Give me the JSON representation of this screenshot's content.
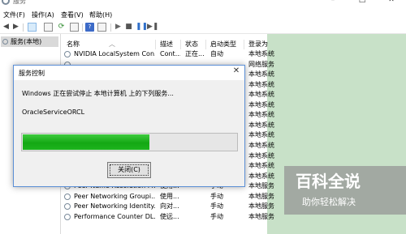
{
  "window": {
    "title": "服务"
  },
  "menu": [
    "文件(F)",
    "操作(A)",
    "查看(V)",
    "帮助(H)"
  ],
  "toolbar": {
    "icons": [
      "back-arrow-icon",
      "forward-arrow-icon",
      "console-tree-icon",
      "list-view-icon",
      "refresh-icon",
      "export-list-icon",
      "help-icon",
      "properties-icon",
      "start-icon",
      "stop-icon",
      "pause-icon",
      "restart-icon"
    ],
    "help_glyph": "?"
  },
  "tree": {
    "root_label": "服务(本地)"
  },
  "columns": {
    "name": "名称",
    "description": "描述",
    "status": "状态",
    "startup": "启动类型",
    "logon": "登录为"
  },
  "services": [
    {
      "name": "NVIDIA LocalSystem Con...",
      "description": "Cont...",
      "status": "正在...",
      "startup": "自动",
      "logon": "本地系统"
    },
    {
      "name": "",
      "description": "",
      "status": "",
      "startup": "",
      "logon": "网络服务"
    },
    {
      "name": "",
      "description": "",
      "status": "",
      "startup": "",
      "logon": "本地系统"
    },
    {
      "name": "",
      "description": "",
      "status": "",
      "startup": "",
      "logon": "本地系统"
    },
    {
      "name": "",
      "description": "",
      "status": "",
      "startup": "",
      "logon": "本地系统"
    },
    {
      "name": "",
      "description": "",
      "status": "",
      "startup": "",
      "logon": "本地系统"
    },
    {
      "name": "",
      "description": "",
      "status": "",
      "startup": "",
      "logon": "本地系统"
    },
    {
      "name": "",
      "description": "",
      "status": "",
      "startup": "",
      "logon": "本地系统"
    },
    {
      "name": "",
      "description": "",
      "status": "",
      "startup": "",
      "logon": "本地系统"
    },
    {
      "name": "",
      "description": "",
      "status": "",
      "startup": "",
      "logon": "本地系统"
    },
    {
      "name": "",
      "description": "",
      "status": "",
      "startup": "",
      "logon": "本地系统"
    },
    {
      "name": "",
      "description": "",
      "status": "",
      "startup": "",
      "logon": "本地系统"
    },
    {
      "name": "",
      "description": "",
      "status": "",
      "startup": "",
      "logon": "本地系统"
    },
    {
      "name": "Peer Name Resolution Pr...",
      "description": "使用...",
      "status": "",
      "startup": "手动",
      "logon": "本地服务"
    },
    {
      "name": "Peer Networking Groupi...",
      "description": "使用...",
      "status": "",
      "startup": "手动",
      "logon": "本地服务"
    },
    {
      "name": "Peer Networking Identity...",
      "description": "向对...",
      "status": "",
      "startup": "手动",
      "logon": "本地服务"
    },
    {
      "name": "Performance Counter DL...",
      "description": "使远...",
      "status": "",
      "startup": "手动",
      "logon": "本地服务"
    }
  ],
  "dialog": {
    "title": "服务控制",
    "close_glyph": "✕",
    "message": "Windows 正在尝试停止 本地计算机 上的下列服务...",
    "service_name": "OracleServiceORCL",
    "progress": 0.59,
    "close_button_label": "关闭(C)"
  },
  "watermark": {
    "title": "百科全说",
    "subtitle": "助你轻松解决"
  },
  "colors": {
    "progress_green": "#14a814",
    "selected_column": "#c8e1c8",
    "dialog_border": "#5b8fd6"
  }
}
